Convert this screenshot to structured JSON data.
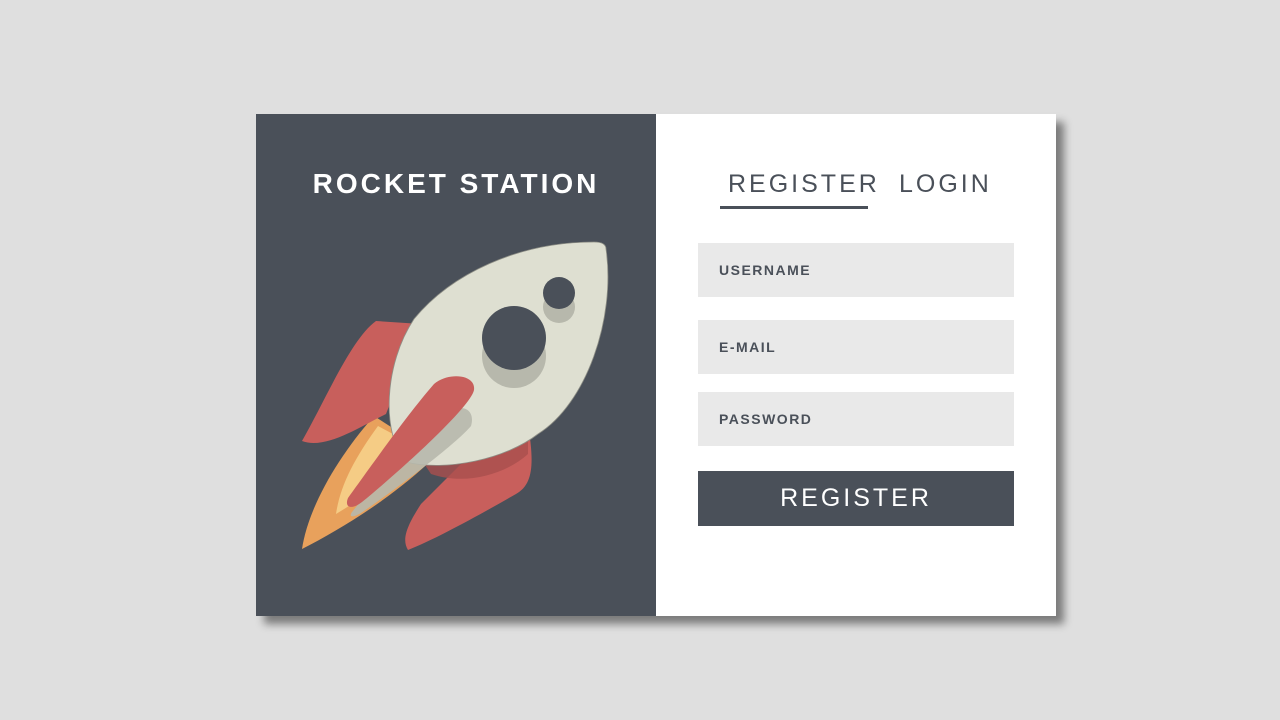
{
  "brand": {
    "title": "ROCKET STATION",
    "illustration": "rocket-icon"
  },
  "tabs": [
    {
      "label": "REGISTER",
      "active": true
    },
    {
      "label": "LOGIN",
      "active": false
    }
  ],
  "form": {
    "username_placeholder": "USERNAME",
    "email_placeholder": "E-MAIL",
    "password_placeholder": "PASSWORD",
    "submit_label": "REGISTER"
  },
  "colors": {
    "background": "#dfdfdf",
    "panel_dark": "#4a5059",
    "field_bg": "#e9e9e9",
    "rocket_body": "#dedfd1",
    "rocket_fin": "#c85f5c",
    "flame": "#e8a15c"
  }
}
